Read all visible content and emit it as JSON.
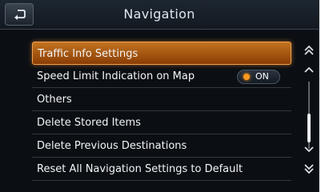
{
  "header": {
    "title": "Navigation",
    "back_icon": "return-arrow-icon"
  },
  "menu": {
    "items": [
      {
        "label": "Traffic Info Settings",
        "selected": true
      },
      {
        "label": "Speed Limit Indication on Map",
        "toggle": "ON"
      },
      {
        "label": "Others"
      },
      {
        "label": "Delete Stored Items"
      },
      {
        "label": "Delete Previous Destinations"
      },
      {
        "label": "Reset All Navigation Settings to Default"
      }
    ]
  },
  "scrollbar": {
    "icons": [
      "double-chevron-up-icon",
      "chevron-up-icon",
      "chevron-down-icon",
      "double-chevron-down-icon"
    ]
  },
  "colors": {
    "selection": "#c2731f",
    "toggle_indicator": "#ff9a1e",
    "background": "#0b0f14"
  }
}
